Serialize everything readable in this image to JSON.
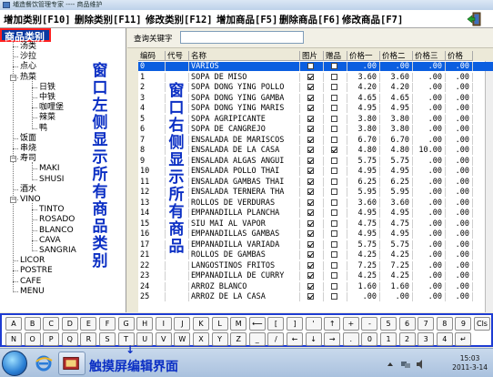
{
  "window": {
    "title": "埔造餐饮管理专家 ---- 商品维护"
  },
  "toolbar": {
    "add_category": "增加类别[F10]",
    "delete_category": "删除类别[F11]",
    "edit_category": "修改类别[F12]",
    "add_item": "增加商品[F5]",
    "delete_item": "删除商品[F6]",
    "edit_item": "修改商品[F7]"
  },
  "category_panel": {
    "header": "商品类别",
    "annotation": "窗口左侧显示所有商品类别",
    "tree": [
      {
        "label": "汤类",
        "level": 1
      },
      {
        "label": "沙拉",
        "level": 1
      },
      {
        "label": "点心",
        "level": 1
      },
      {
        "label": "热菜",
        "level": 1,
        "expanded": true
      },
      {
        "label": "日铁",
        "level": 2
      },
      {
        "label": "中铁",
        "level": 2
      },
      {
        "label": "咖哩堡",
        "level": 2
      },
      {
        "label": "辣菜",
        "level": 2
      },
      {
        "label": "鸭",
        "level": 2
      },
      {
        "label": "饭面",
        "level": 1
      },
      {
        "label": "串烧",
        "level": 1
      },
      {
        "label": "寿司",
        "level": 1,
        "expanded": true
      },
      {
        "label": "MAKI",
        "level": 2
      },
      {
        "label": "SHUSI",
        "level": 2
      },
      {
        "label": "酒水",
        "level": 1
      },
      {
        "label": "VINO",
        "level": 1,
        "expanded": true
      },
      {
        "label": "TINTO",
        "level": 2
      },
      {
        "label": "ROSADO",
        "level": 2
      },
      {
        "label": "BLANCO",
        "level": 2
      },
      {
        "label": "CAVA",
        "level": 2
      },
      {
        "label": "SANGRIA",
        "level": 2
      },
      {
        "label": "LICOR",
        "level": 1
      },
      {
        "label": "POSTRE",
        "level": 1
      },
      {
        "label": "CAFE",
        "level": 1
      },
      {
        "label": "MENU",
        "level": 1
      }
    ]
  },
  "search": {
    "label": "查询关键字",
    "value": ""
  },
  "product_grid": {
    "annotation": "窗口右侧显示所有商品",
    "columns": [
      "编码",
      "代号",
      "名称",
      "图片",
      "赠品",
      "价格一",
      "价格二",
      "价格三",
      "价格"
    ],
    "rows": [
      {
        "code": "0",
        "alias": "",
        "name": "VARIOS",
        "img": false,
        "gift": false,
        "p1": ".00",
        "p2": ".00",
        "p3": ".00",
        "p4": ".00",
        "selected": true
      },
      {
        "code": "1",
        "alias": "",
        "name": "SOPA DE MISO",
        "img": true,
        "gift": false,
        "p1": "3.60",
        "p2": "3.60",
        "p3": ".00",
        "p4": ".00"
      },
      {
        "code": "2",
        "alias": "",
        "name": "SOPA DONG YING POLLO",
        "img": true,
        "gift": false,
        "p1": "4.20",
        "p2": "4.20",
        "p3": ".00",
        "p4": ".00"
      },
      {
        "code": "3",
        "alias": "",
        "name": "SOPA DONG YING GAMBA",
        "img": true,
        "gift": false,
        "p1": "4.65",
        "p2": "4.65",
        "p3": ".00",
        "p4": ".00"
      },
      {
        "code": "4",
        "alias": "",
        "name": "SOPA DONG YING MARIS",
        "img": true,
        "gift": false,
        "p1": "4.95",
        "p2": "4.95",
        "p3": ".00",
        "p4": ".00"
      },
      {
        "code": "5",
        "alias": "",
        "name": "SOPA AGRIPICANTE",
        "img": true,
        "gift": false,
        "p1": "3.80",
        "p2": "3.80",
        "p3": ".00",
        "p4": ".00"
      },
      {
        "code": "6",
        "alias": "",
        "name": "SOPA DE CANGREJO",
        "img": true,
        "gift": false,
        "p1": "3.80",
        "p2": "3.80",
        "p3": ".00",
        "p4": ".00"
      },
      {
        "code": "7",
        "alias": "",
        "name": "ENSALADA DE MARISCOS",
        "img": true,
        "gift": false,
        "p1": "6.70",
        "p2": "6.70",
        "p3": ".00",
        "p4": ".00"
      },
      {
        "code": "8",
        "alias": "",
        "name": "ENSALADA DE LA CASA",
        "img": true,
        "gift": true,
        "p1": "4.80",
        "p2": "4.80",
        "p3": "10.00",
        "p4": ".00"
      },
      {
        "code": "9",
        "alias": "",
        "name": "ENSALADA ALGAS ANGUI",
        "img": true,
        "gift": false,
        "p1": "5.75",
        "p2": "5.75",
        "p3": ".00",
        "p4": ".00"
      },
      {
        "code": "10",
        "alias": "",
        "name": "ENSALADA POLLO THAI",
        "img": true,
        "gift": false,
        "p1": "4.95",
        "p2": "4.95",
        "p3": ".00",
        "p4": ".00"
      },
      {
        "code": "11",
        "alias": "",
        "name": "ENSALADA GAMBAS THAI",
        "img": true,
        "gift": false,
        "p1": "6.25",
        "p2": "6.25",
        "p3": ".00",
        "p4": ".00"
      },
      {
        "code": "12",
        "alias": "",
        "name": "ENSALADA TERNERA THA",
        "img": true,
        "gift": false,
        "p1": "5.95",
        "p2": "5.95",
        "p3": ".00",
        "p4": ".00"
      },
      {
        "code": "13",
        "alias": "",
        "name": "ROLLOS DE VERDURAS",
        "img": true,
        "gift": false,
        "p1": "3.60",
        "p2": "3.60",
        "p3": ".00",
        "p4": ".00"
      },
      {
        "code": "14",
        "alias": "",
        "name": "EMPANADILLA PLANCHA",
        "img": true,
        "gift": false,
        "p1": "4.95",
        "p2": "4.95",
        "p3": ".00",
        "p4": ".00"
      },
      {
        "code": "15",
        "alias": "",
        "name": "SIU MAI AL VAPOR",
        "img": true,
        "gift": false,
        "p1": "4.75",
        "p2": "4.75",
        "p3": ".00",
        "p4": ".00"
      },
      {
        "code": "16",
        "alias": "",
        "name": "EMPANADILLAS GAMBAS",
        "img": true,
        "gift": false,
        "p1": "4.95",
        "p2": "4.95",
        "p3": ".00",
        "p4": ".00"
      },
      {
        "code": "17",
        "alias": "",
        "name": "EMPANADILLA VARIADA",
        "img": true,
        "gift": false,
        "p1": "5.75",
        "p2": "5.75",
        "p3": ".00",
        "p4": ".00"
      },
      {
        "code": "21",
        "alias": "",
        "name": "ROLLOS DE GAMBAS",
        "img": true,
        "gift": false,
        "p1": "4.25",
        "p2": "4.25",
        "p3": ".00",
        "p4": ".00"
      },
      {
        "code": "22",
        "alias": "",
        "name": "LANGOSTINOS FRITOS",
        "img": true,
        "gift": false,
        "p1": "7.25",
        "p2": "7.25",
        "p3": ".00",
        "p4": ".00"
      },
      {
        "code": "23",
        "alias": "",
        "name": "EMPANADILLA DE CURRY",
        "img": true,
        "gift": false,
        "p1": "4.25",
        "p2": "4.25",
        "p3": ".00",
        "p4": ".00"
      },
      {
        "code": "24",
        "alias": "",
        "name": "ARROZ BLANCO",
        "img": true,
        "gift": false,
        "p1": "1.60",
        "p2": "1.60",
        "p3": ".00",
        "p4": ".00"
      },
      {
        "code": "25",
        "alias": "",
        "name": "ARROZ DE LA CASA",
        "img": true,
        "gift": false,
        "p1": ".00",
        "p2": ".00",
        "p3": ".00",
        "p4": ".00"
      }
    ]
  },
  "keyboard": {
    "row1": [
      "A",
      "B",
      "C",
      "D",
      "E",
      "F",
      "G",
      "H",
      "I",
      "J",
      "K",
      "L",
      "M",
      "⟵",
      "[",
      "]",
      "'",
      "↑",
      "+",
      "-",
      "5",
      "6",
      "7",
      "8",
      "9",
      "Cls"
    ],
    "row2": [
      "N",
      "O",
      "P",
      "Q",
      "R",
      "S",
      "T",
      "U",
      "V",
      "W",
      "X",
      "Y",
      "Z",
      "_",
      "/",
      "←",
      "↓",
      "→",
      ".",
      "0",
      "1",
      "2",
      "3",
      "4",
      "↵"
    ]
  },
  "taskbar": {
    "annotation": "触摸屏编辑界面",
    "time": "15:03",
    "date": "2011-3-14"
  }
}
